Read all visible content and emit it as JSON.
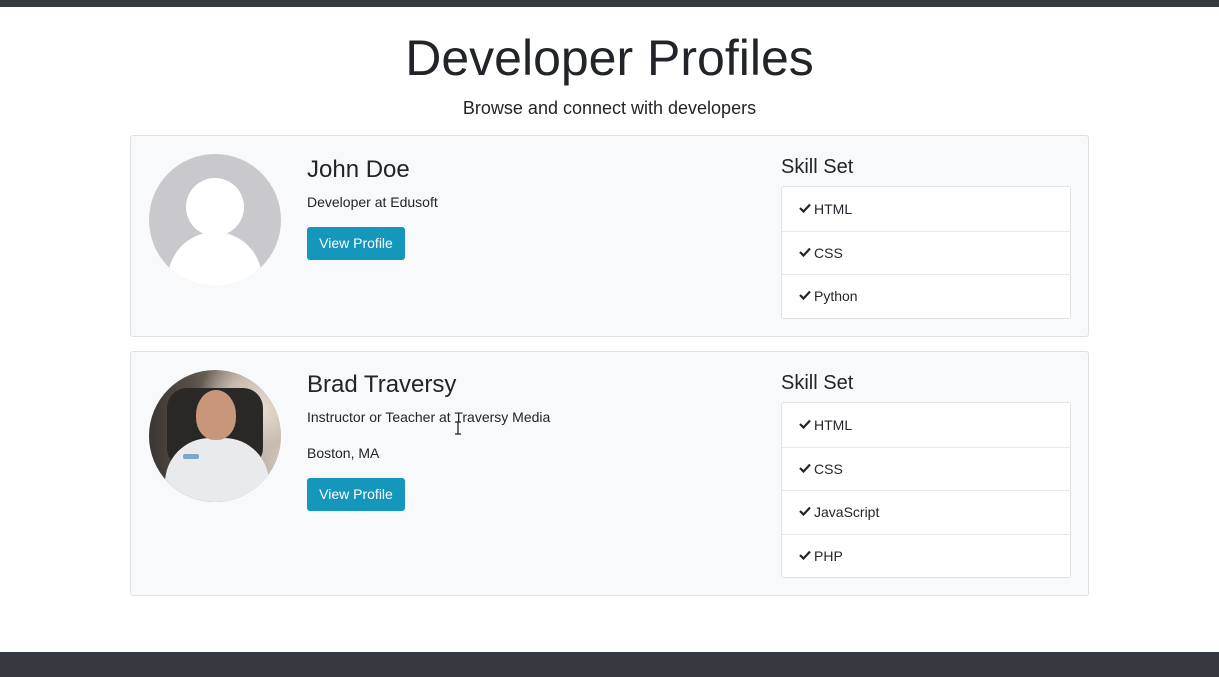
{
  "header": {
    "title": "Developer Profiles",
    "subtitle": "Browse and connect with developers"
  },
  "profiles": [
    {
      "name": "John Doe",
      "role": "Developer at Edusoft",
      "location": "",
      "avatar": "default-user-avatar",
      "button_label": "View Profile",
      "skills_title": "Skill Set",
      "skills": [
        "HTML",
        "CSS",
        "Python"
      ]
    },
    {
      "name": "Brad Traversy",
      "role": "Instructor or Teacher at Traversy Media",
      "location": "Boston, MA",
      "avatar": "photo-avatar",
      "button_label": "View Profile",
      "skills_title": "Skill Set",
      "skills": [
        "HTML",
        "CSS",
        "JavaScript",
        "PHP"
      ]
    }
  ],
  "colors": {
    "accent": "#1596bb",
    "topbar": "#343a40",
    "footer": "#343a40",
    "card_bg": "#f8f9fb"
  },
  "icons": {
    "skill_check": "check-icon",
    "text_cursor": "text-cursor-icon"
  }
}
